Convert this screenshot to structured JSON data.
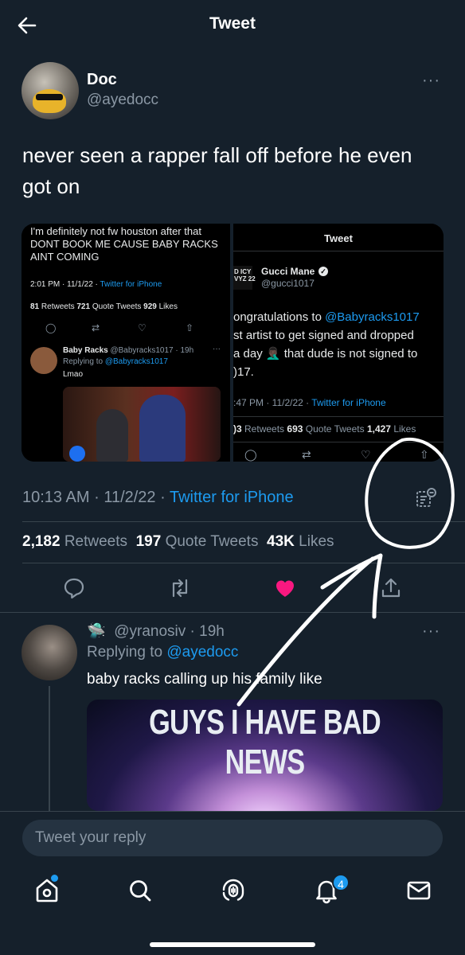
{
  "header": {
    "title": "Tweet"
  },
  "tweet": {
    "author_name": "Doc",
    "author_handle": "@ayedocc",
    "text": "never seen a rapper fall off before he even got on",
    "meta": {
      "time": "10:13 AM",
      "date": "11/2/22",
      "source": "Twitter for iPhone",
      "sep": "·"
    },
    "stats": {
      "retweets": "2,182",
      "retweets_label": "Retweets",
      "quotes": "197",
      "quotes_label": "Quote Tweets",
      "likes": "43K",
      "likes_label": "Likes"
    },
    "liked": true
  },
  "media_left": {
    "quote_text": "I'm definitely not fw houston after that DONT BOOK ME CAUSE BABY RACKS AINT COMING",
    "meta_time": "2:01 PM · 11/1/22 · ",
    "meta_source": "Twitter for iPhone",
    "stats": {
      "retweets": "81",
      "retweets_label": "Retweets",
      "quotes": "721",
      "quotes_label": "Quote Tweets",
      "likes": "929",
      "likes_label": "Likes"
    },
    "reply_name": "Baby Racks",
    "reply_handle": "@Babyracks1017 · 19h",
    "reply_to_prefix": "Replying to ",
    "reply_to": "@Babyracks1017",
    "reply_text": "Lmao",
    "reply_more": "···"
  },
  "media_right": {
    "title": "Tweet",
    "avatar_text": "D ICY\nVYZ 22",
    "name": "Gucci Mane",
    "verified": "✓",
    "handle": "@gucci1017",
    "line1_prefix": "ongratulations to ",
    "line1_mention": "@Babyracks1017",
    "line2": "st artist to get signed and dropped",
    "line3": " a day 🤦🏿‍♂️ that dude is not signed to",
    "line4": ")17.",
    "meta_time": ":47 PM · 11/2/22 · ",
    "meta_source": "Twitter for iPhone",
    "stats": {
      "retweets": ")3",
      "retweets_label": "Retweets",
      "quotes": "693",
      "quotes_label": "Quote Tweets",
      "likes": "1,427",
      "likes_label": "Likes"
    }
  },
  "reply": {
    "emoji": "🛸",
    "handle": "@yranosiv",
    "time": "19h",
    "replying_prefix": "Replying to ",
    "replying_to": "@ayedocc",
    "text": "baby racks calling up his family like",
    "media_caption": "GUYS I HAVE BAD NEWS"
  },
  "compose": {
    "placeholder": "Tweet your reply"
  },
  "nav": {
    "notifications_badge": "4"
  },
  "colors": {
    "background": "#15202b",
    "accent": "#1d9bf0",
    "like": "#f91880",
    "muted": "#8b98a5"
  },
  "icons": [
    "back-arrow-icon",
    "more-icon",
    "translate-icon",
    "reply-icon",
    "retweet-icon",
    "heart-icon",
    "share-icon",
    "home-icon",
    "search-icon",
    "spaces-icon",
    "bell-icon",
    "mail-icon"
  ]
}
